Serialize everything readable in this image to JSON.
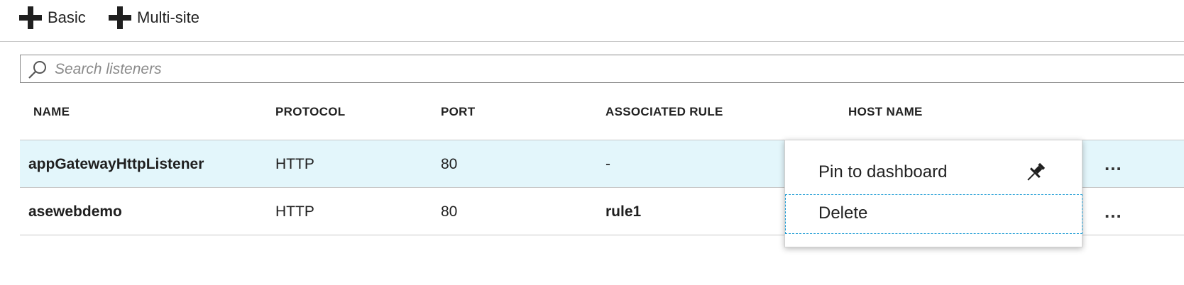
{
  "toolbar": {
    "basic_label": "Basic",
    "multisite_label": "Multi-site"
  },
  "search": {
    "placeholder": "Search listeners",
    "value": ""
  },
  "table": {
    "columns": [
      "NAME",
      "PROTOCOL",
      "PORT",
      "ASSOCIATED RULE",
      "HOST NAME"
    ],
    "rows": [
      {
        "name": "appGatewayHttpListener",
        "protocol": "HTTP",
        "port": "80",
        "rule": "-",
        "host": "",
        "more": "..."
      },
      {
        "name": "asewebdemo",
        "protocol": "HTTP",
        "port": "80",
        "rule": "rule1",
        "host": "",
        "more": "..."
      }
    ]
  },
  "context_menu": {
    "pin_label": "Pin to dashboard",
    "delete_label": "Delete"
  },
  "icons": {
    "add": "plus-icon",
    "search": "search-icon",
    "pin": "pin-icon",
    "more": "ellipsis-icon"
  },
  "colors": {
    "selected_row": "#e3f6fb",
    "focus_border": "#1b9bd4"
  }
}
